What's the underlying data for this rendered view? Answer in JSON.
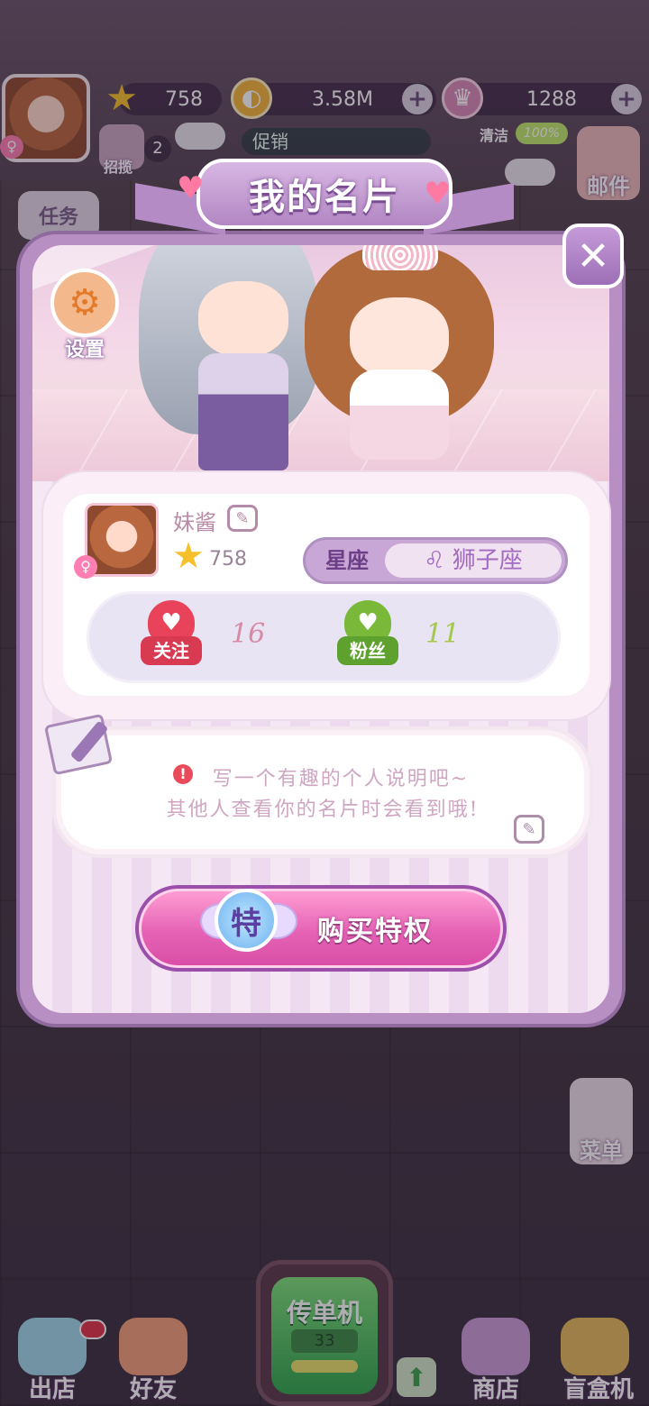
{
  "hud": {
    "stars": "758",
    "coins": "3.58M",
    "gems": "1288",
    "recruit_label": "招揽",
    "recruit_count": "2",
    "promo_label": "促销",
    "clean_label": "清洁",
    "clean_value": "100%",
    "mail_label": "邮件",
    "task_label": "任务",
    "menu_label": "菜单"
  },
  "modal": {
    "title": "我的名片",
    "close_symbol": "✕",
    "settings_label": "设置",
    "profile": {
      "nickname": "妹酱",
      "level": "758",
      "gender_symbol": "♀",
      "zodiac_label": "星座",
      "zodiac_value": "♌ 狮子座"
    },
    "stats": {
      "follow_label": "关注",
      "follow_count": "16",
      "fans_label": "粉丝",
      "fans_count": "11"
    },
    "description": {
      "line1": "写一个有趣的个人说明吧~",
      "line2": "其他人查看你的名片时会看到哦!"
    },
    "buy_label": "购买特权",
    "privilege_char": "特"
  },
  "bottom_bar": {
    "store_out": "出店",
    "friends": "好友",
    "flyer_title": "传单机",
    "flyer_count": "33",
    "shop": "商店",
    "blindbox": "盲盒机"
  },
  "colors": {
    "modal_bg": "#b88fc2",
    "accent_pink": "#e563b5",
    "follow_red": "#e8435a",
    "fans_green": "#7ab83a"
  },
  "icons": [
    "star-icon",
    "coin-icon",
    "crown-icon",
    "plus-icon",
    "gear-icon",
    "close-icon",
    "edit-icon",
    "heart-icon",
    "note-icon",
    "warning-icon"
  ]
}
